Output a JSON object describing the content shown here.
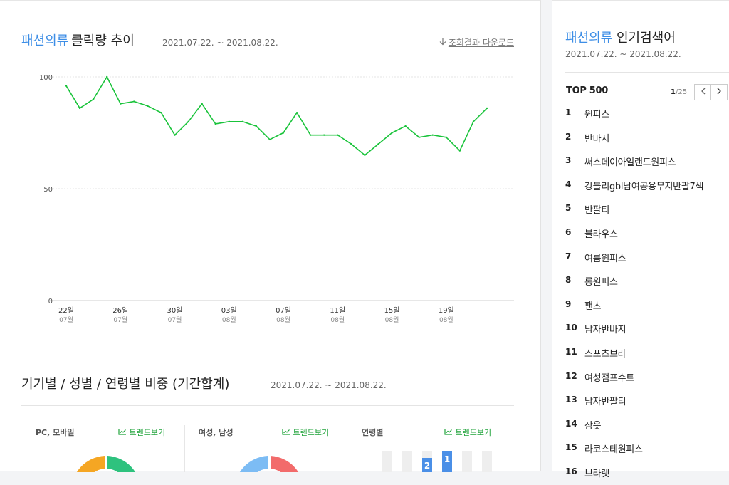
{
  "main": {
    "chart_header": {
      "category": "패션의류",
      "title": "클릭량 추이",
      "period": "2021.07.22. ~ 2021.08.22.",
      "download_label": "조회결과 다운로드",
      "download_icon": "download-arrow-icon"
    },
    "breakdown": {
      "title": "기기별 / 성별 / 연령별 비중 (기간합계)",
      "period": "2021.07.22. ~ 2021.08.22.",
      "trend_label": "트렌드보기",
      "trend_icon": "trend-chart-icon",
      "device_label": "PC, 모바일",
      "gender_label": "여성, 남성",
      "age_label": "연령별",
      "age_badges": [
        "2",
        "1"
      ],
      "colors": {
        "pc": "#f5a623",
        "mobile": "#2ec27e",
        "female": "#f26b6b",
        "male": "#7cbcf4",
        "age_bar_bg": "#eeeeee",
        "age_bar_highlight": "#4a8fe7"
      }
    }
  },
  "sidebar": {
    "category": "패션의류",
    "title": "인기검색어",
    "period": "2021.07.22. ~ 2021.08.22.",
    "top_label": "TOP 500",
    "page_current": "1",
    "page_total": "/25",
    "prev_icon": "chevron-left-icon",
    "next_icon": "chevron-right-icon",
    "keywords": [
      {
        "rank": "1",
        "name": "원피스"
      },
      {
        "rank": "2",
        "name": "반바지"
      },
      {
        "rank": "3",
        "name": "써스데이아일랜드원피스"
      },
      {
        "rank": "4",
        "name": "강블리gbl남여공용무지반팔7색"
      },
      {
        "rank": "5",
        "name": "반팔티"
      },
      {
        "rank": "6",
        "name": "블라우스"
      },
      {
        "rank": "7",
        "name": "여름원피스"
      },
      {
        "rank": "8",
        "name": "롱원피스"
      },
      {
        "rank": "9",
        "name": "팬츠"
      },
      {
        "rank": "10",
        "name": "남자반바지"
      },
      {
        "rank": "11",
        "name": "스포츠브라"
      },
      {
        "rank": "12",
        "name": "여성점프수트"
      },
      {
        "rank": "13",
        "name": "남자반팔티"
      },
      {
        "rank": "14",
        "name": "잠옷"
      },
      {
        "rank": "15",
        "name": "라코스테원피스"
      },
      {
        "rank": "16",
        "name": "브라렛"
      }
    ]
  },
  "chart_data": {
    "type": "line",
    "title": "클릭량 추이",
    "xlabel": "",
    "ylabel": "",
    "ylim": [
      0,
      100
    ],
    "yticks": [
      0,
      50,
      100
    ],
    "grid": true,
    "line_color": "#19c33a",
    "x": [
      "07.22",
      "07.23",
      "07.24",
      "07.25",
      "07.26",
      "07.27",
      "07.28",
      "07.29",
      "07.30",
      "07.31",
      "08.01",
      "08.02",
      "08.03",
      "08.04",
      "08.05",
      "08.06",
      "08.07",
      "08.08",
      "08.09",
      "08.10",
      "08.11",
      "08.12",
      "08.13",
      "08.14",
      "08.15",
      "08.16",
      "08.17",
      "08.18",
      "08.19",
      "08.20",
      "08.21",
      "08.22"
    ],
    "x_tick_labels": [
      {
        "day": "22일",
        "month": "07월",
        "index": 0
      },
      {
        "day": "26일",
        "month": "07월",
        "index": 4
      },
      {
        "day": "30일",
        "month": "07월",
        "index": 8
      },
      {
        "day": "03일",
        "month": "08월",
        "index": 12
      },
      {
        "day": "07일",
        "month": "08월",
        "index": 16
      },
      {
        "day": "11일",
        "month": "08월",
        "index": 20
      },
      {
        "day": "15일",
        "month": "08월",
        "index": 24
      },
      {
        "day": "19일",
        "month": "08월",
        "index": 28
      }
    ],
    "series": [
      {
        "values": [
          96,
          86,
          90,
          100,
          88,
          89,
          87,
          84,
          74,
          80,
          88,
          79,
          80,
          80,
          78,
          72,
          75,
          84,
          74,
          74,
          74,
          70,
          65,
          70,
          75,
          78,
          73,
          74,
          73,
          67,
          80,
          86
        ]
      }
    ]
  }
}
